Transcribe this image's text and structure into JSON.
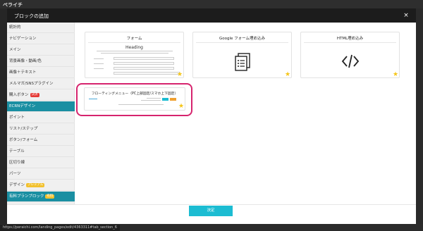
{
  "app": {
    "logo": "ペライチ"
  },
  "modal": {
    "title": "ブロックの追加",
    "close": "×"
  },
  "sidebar": {
    "items": [
      {
        "label": "統計的"
      },
      {
        "label": "ナビゲーション"
      },
      {
        "label": "メイン"
      },
      {
        "label": "背景画像・動画/色"
      },
      {
        "label": "画像＋テキスト"
      },
      {
        "label": "メルマガ/SNSプラグイン"
      },
      {
        "label": "購入ボタン",
        "badge": "決済"
      },
      {
        "label": "ECRNデザイン"
      },
      {
        "label": "ポイント"
      },
      {
        "label": "リスト/ステップ"
      },
      {
        "label": "ボタン/フォーム"
      },
      {
        "label": "テーブル"
      },
      {
        "label": "区切り線"
      },
      {
        "label": "パーツ"
      },
      {
        "label": "デザイン",
        "badge": "プレミアム"
      },
      {
        "label": "有料プランブロック",
        "badge": "有料"
      }
    ]
  },
  "cards": {
    "form": {
      "title": "フォーム",
      "preview_heading": "Heading"
    },
    "google_form": {
      "title": "Google フォーム埋め込み",
      "icon": "form-document-icon"
    },
    "html": {
      "title": "HTML埋め込み",
      "icon": "</>"
    },
    "floating": {
      "title": "フローティングメニュー（PC上部固定/スマホ上下固定）"
    }
  },
  "footer": {
    "decide_label": "決定"
  },
  "status_bar": {
    "url": "https://peraichi.com/landing_pages/edit/4363311#tab_section_6"
  },
  "colors": {
    "accent": "#1cbcd2",
    "active_nav": "#1a8fa2",
    "highlight": "#d6246e",
    "star": "#f5c518"
  }
}
